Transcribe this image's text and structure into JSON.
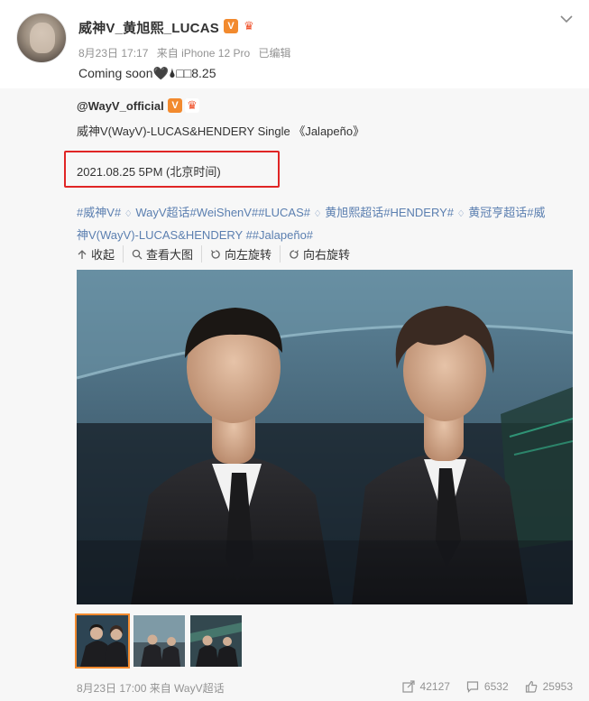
{
  "post": {
    "username": "威神V_黄旭熙_LUCAS",
    "meta": {
      "date": "8月23日 17:17",
      "source": "来自 iPhone 12 Pro",
      "edited": "已编辑"
    },
    "caption": "Coming soon🖤🌢□□8.25"
  },
  "repost": {
    "author": "@WayV_official",
    "title": "威神V(WayV)-LUCAS&HENDERY Single 《Jalapeño》",
    "date_line": "2021.08.25 5PM (北京时间)",
    "tags_line1": [
      {
        "text": "#威神V#",
        "diamond": false
      },
      {
        "text": "WayV超话#WeiShenV##LUCAS#",
        "diamond": true
      },
      {
        "text": "黄旭熙超话#HENDERY#",
        "diamond": true
      },
      {
        "text": "黄冠亨超话#威",
        "diamond": true
      }
    ],
    "tags_line2": "神V(WayV)-LUCAS&HENDERY ##Jalapeño#",
    "actions": {
      "collapse": "收起",
      "view_large": "查看大图",
      "rotate_left": "向左旋转",
      "rotate_right": "向右旋转"
    },
    "footer": {
      "time": "8月23日 17:00 来自 WayV超话",
      "reposts": "42127",
      "comments": "6532",
      "likes": "25953"
    }
  },
  "badges": {
    "verified": "V",
    "crown": "♛"
  },
  "colors": {
    "accent": "#f28a2e",
    "link": "#5b7fb0",
    "highlight": "#e02525"
  },
  "icons": [
    "chevron-down-icon",
    "collapse-icon",
    "search-icon",
    "rotate-left-icon",
    "rotate-right-icon",
    "share-icon",
    "comment-icon",
    "like-icon"
  ]
}
